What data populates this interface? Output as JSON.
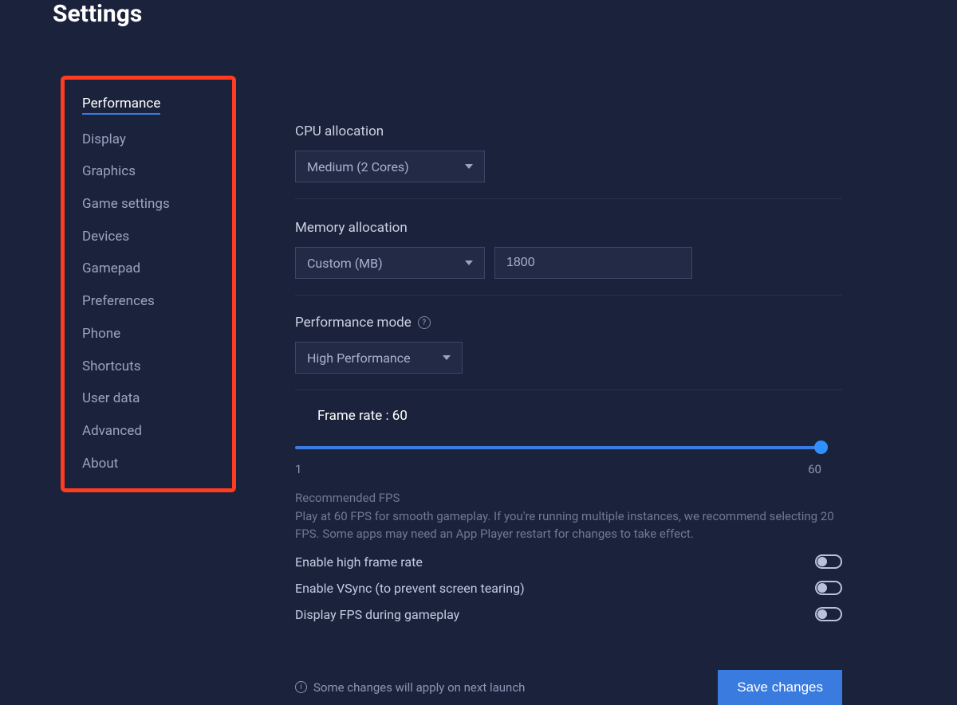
{
  "title": "Settings",
  "sidebar": {
    "items": [
      {
        "label": "Performance",
        "active": true
      },
      {
        "label": "Display"
      },
      {
        "label": "Graphics"
      },
      {
        "label": "Game settings"
      },
      {
        "label": "Devices"
      },
      {
        "label": "Gamepad"
      },
      {
        "label": "Preferences"
      },
      {
        "label": "Phone"
      },
      {
        "label": "Shortcuts"
      },
      {
        "label": "User data"
      },
      {
        "label": "Advanced"
      },
      {
        "label": "About"
      }
    ]
  },
  "cpu": {
    "label": "CPU allocation",
    "value": "Medium (2 Cores)"
  },
  "memory": {
    "label": "Memory allocation",
    "mode": "Custom (MB)",
    "value": "1800"
  },
  "perf_mode": {
    "label": "Performance mode",
    "value": "High Performance"
  },
  "frame_rate": {
    "label": "Frame rate : 60",
    "min": "1",
    "max": "60",
    "value": 60
  },
  "recommended": {
    "title": "Recommended FPS",
    "text": "Play at 60 FPS for smooth gameplay. If you're running multiple instances, we recommend selecting 20 FPS. Some apps may need an App Player restart for changes to take effect."
  },
  "toggles": {
    "high_fps": "Enable high frame rate",
    "vsync": "Enable VSync (to prevent screen tearing)",
    "display_fps": "Display FPS during gameplay"
  },
  "footer": {
    "note": "Some changes will apply on next launch",
    "save": "Save changes"
  }
}
